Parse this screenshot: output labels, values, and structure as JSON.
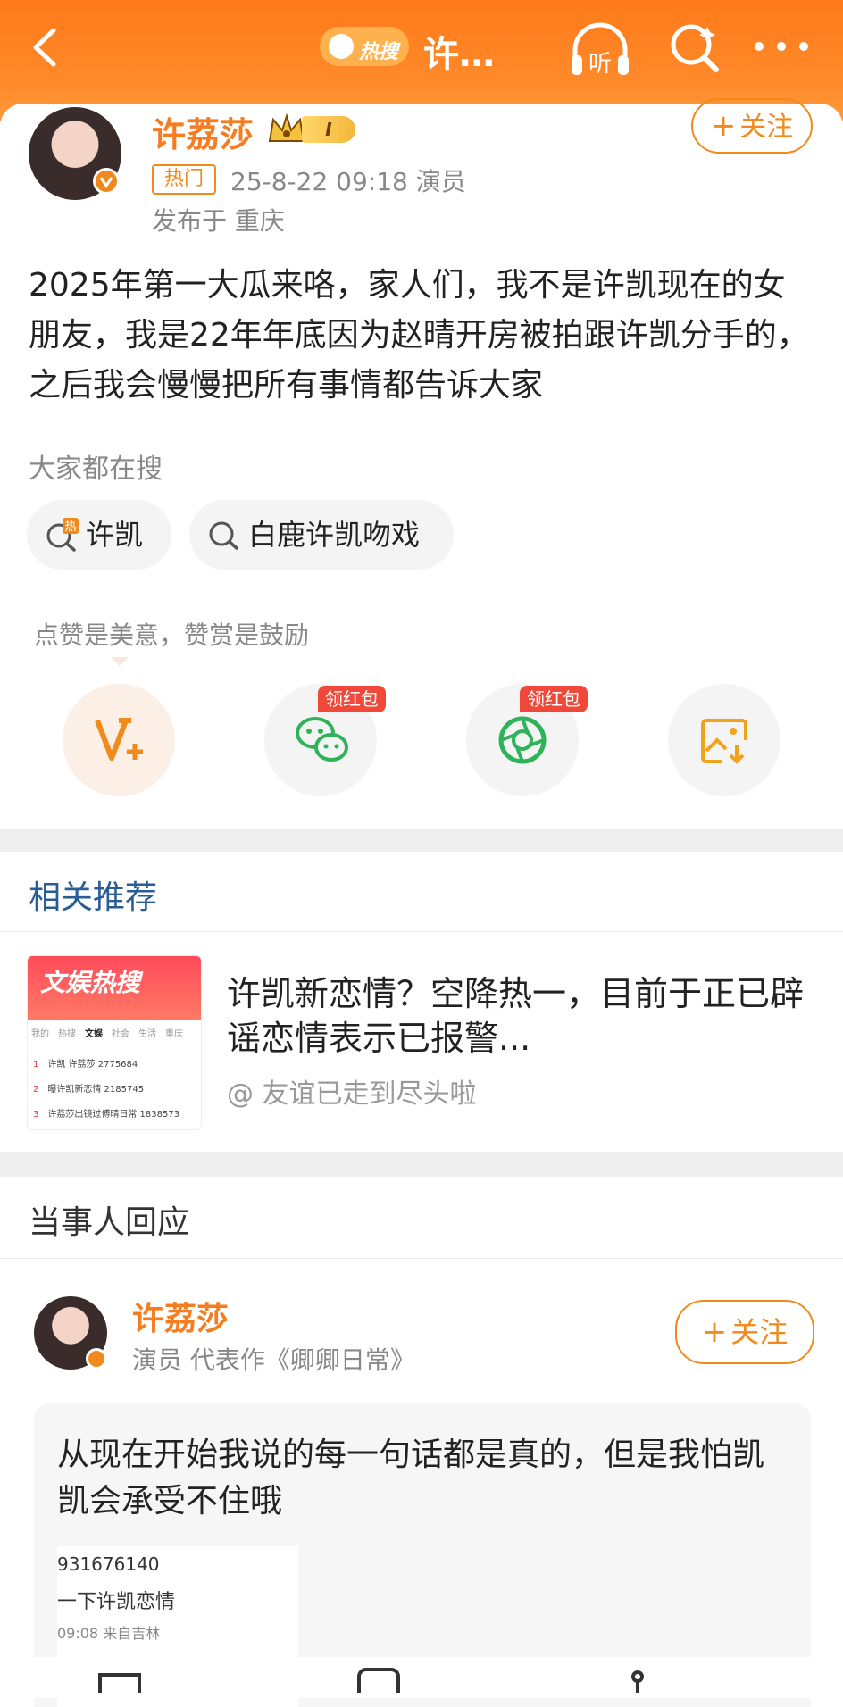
{
  "header": {
    "hot_search_label": "热搜",
    "title": "许…",
    "listen_label": "听"
  },
  "post": {
    "username": "许荔莎",
    "vip_level": "I",
    "follow_label": "关注",
    "hot_tag": "热门",
    "meta": "25-8-22 09:18  演员",
    "location": "发布于 重庆",
    "body": "2025年第一大瓜来咯，家人们，我不是许凯现在的女朋友，我是22年年底因为赵晴开房被拍跟许凯分手的，之后我会慢慢把所有事情都告诉大家",
    "search_section_title": "大家都在搜",
    "search_chips": [
      "许凯",
      "白鹿许凯吻戏"
    ],
    "hot_chip_badge": "热",
    "appreciation_text": "点赞是美意，赞赏是鼓励",
    "reward_badges": [
      "领红包",
      "领红包"
    ]
  },
  "related": {
    "section_title": "相关推荐",
    "thumb_banner": "文娱热搜",
    "thumb_tabs": [
      "我的",
      "热搜",
      "文娱",
      "社会",
      "生活",
      "重庆"
    ],
    "thumb_rows": [
      {
        "rank": "1",
        "text": "许凯 许荔莎  2775684"
      },
      {
        "rank": "2",
        "text": "曝许凯新恋情  2185745"
      },
      {
        "rank": "3",
        "text": "许荔莎出镜过傅晴日常  1838573"
      }
    ],
    "title": "许凯新恋情？空降热一，目前于正已辟谣恋情表示已报警...",
    "author": "@ 友谊已走到尽头啦"
  },
  "reply": {
    "section_title": "当事人回应",
    "name": "许荔莎",
    "subtitle": "演员 代表作《卿卿日常》",
    "follow_label": "关注",
    "text": "从现在开始我说的每一句话都是真的，但是我怕凯凯会承受不住哦",
    "shot_lines": [
      "931676140",
      "一下许凯恋情",
      "09:08 来自吉林"
    ]
  },
  "colors": {
    "brand_orange": "#ff8a2a",
    "accent_orange": "#f08a1c",
    "reward_red": "#f0493a"
  }
}
